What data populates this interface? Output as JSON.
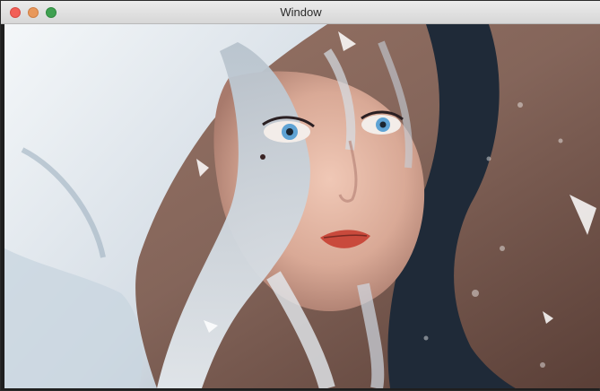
{
  "window": {
    "title": "Window",
    "controls": {
      "close_color": "#f25f57",
      "minimize_color": "#e8985b",
      "maximize_color": "#3fa051"
    }
  },
  "content": {
    "type": "digital painting",
    "colors": {
      "background_warm": "#8a6a5c",
      "hood_white": "#e9eef2",
      "hair_silver": "#c9d2db",
      "skin": "#e6b9a6",
      "eye_blue": "#5fa3d4",
      "lips_red": "#c94a3c",
      "hair_dark": "#1f2a38"
    }
  }
}
